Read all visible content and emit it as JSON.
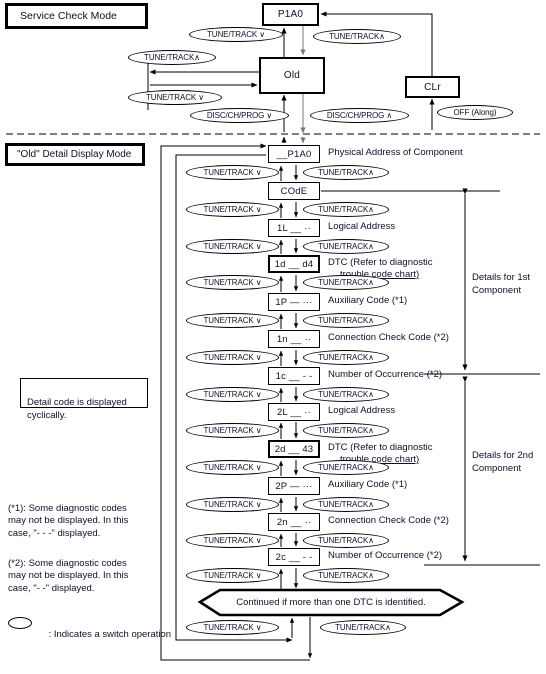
{
  "diagram": {
    "title": "Service Check Mode flow chart",
    "headers": {
      "service_check_mode": "Service Check Mode",
      "old_detail_display_mode": "\"Old\" Detail Display Mode"
    },
    "top_section": {
      "boxes": {
        "p1a0": "P1A0",
        "old": "Old",
        "clr": "CLr"
      },
      "switches": {
        "tune_down_a": "TUNE/TRACK ∨",
        "tune_up_a": "TUNE/TRACK∧",
        "tune_up_b": "TUNE/TRACK∧",
        "tune_down_b": "TUNE/TRACK ∨",
        "disc_down": "DISC/CH/PROG ∨",
        "disc_up": "DISC/CH/PROG ∧",
        "off_along": "OFF  (Along)"
      }
    },
    "detail_section": {
      "switch_down": "TUNE/TRACK ∨",
      "switch_up": "TUNE/TRACK∧",
      "rows": [
        {
          "code": "__P1A0",
          "label": "Physical Address of Component",
          "label2": "",
          "thick": false
        },
        {
          "code": "COdE",
          "label": "",
          "label2": "",
          "thick": false
        },
        {
          "code": "1L __ ··",
          "label": "Logical Address",
          "label2": "",
          "thick": false
        },
        {
          "code": "1d __ d4",
          "label": "DTC (Refer to diagnostic",
          "label2": "trouble code chart)",
          "thick": true
        },
        {
          "code": "1P — ···",
          "label": "Auxiliary Code (*1)",
          "label2": "",
          "thick": false
        },
        {
          "code": "1n __ ··",
          "label": "Connection Check Code (*2)",
          "label2": "",
          "thick": false
        },
        {
          "code": "1c __ -  -",
          "label": "Number of Occurrence (*2)",
          "label2": "",
          "thick": false
        },
        {
          "code": "2L __ ··",
          "label": "Logical Address",
          "label2": "",
          "thick": false
        },
        {
          "code": "2d __ 43",
          "label": "DTC (Refer to diagnostic",
          "label2": "trouble code chart)",
          "thick": true
        },
        {
          "code": "2P — ···",
          "label": "Auxiliary Code (*1)",
          "label2": "",
          "thick": false
        },
        {
          "code": "2n __ ··",
          "label": "Connection Check Code (*2)",
          "label2": "",
          "thick": false
        },
        {
          "code": "2c __ -  -",
          "label": "Number of Occurrence (*2)",
          "label2": "",
          "thick": false
        }
      ],
      "continued_hexagon": "Continued if more than one DTC is identified.",
      "brackets": [
        {
          "line1": "Details for 1st",
          "line2": "Component"
        },
        {
          "line1": "Details for 2nd",
          "line2": "Component"
        }
      ]
    },
    "notes": {
      "cyclic_box": "Detail code is displayed\ncyclically.",
      "note1": "(*1): Some diagnostic codes\n  may not be displayed. In this\n  case, \"-  -  -\" displayed.",
      "note2": "(*2): Some diagnostic codes\n  may not be displayed. In this\n  case, \"-  -\" displayed.",
      "legend": ": Indicates a switch operation"
    }
  }
}
